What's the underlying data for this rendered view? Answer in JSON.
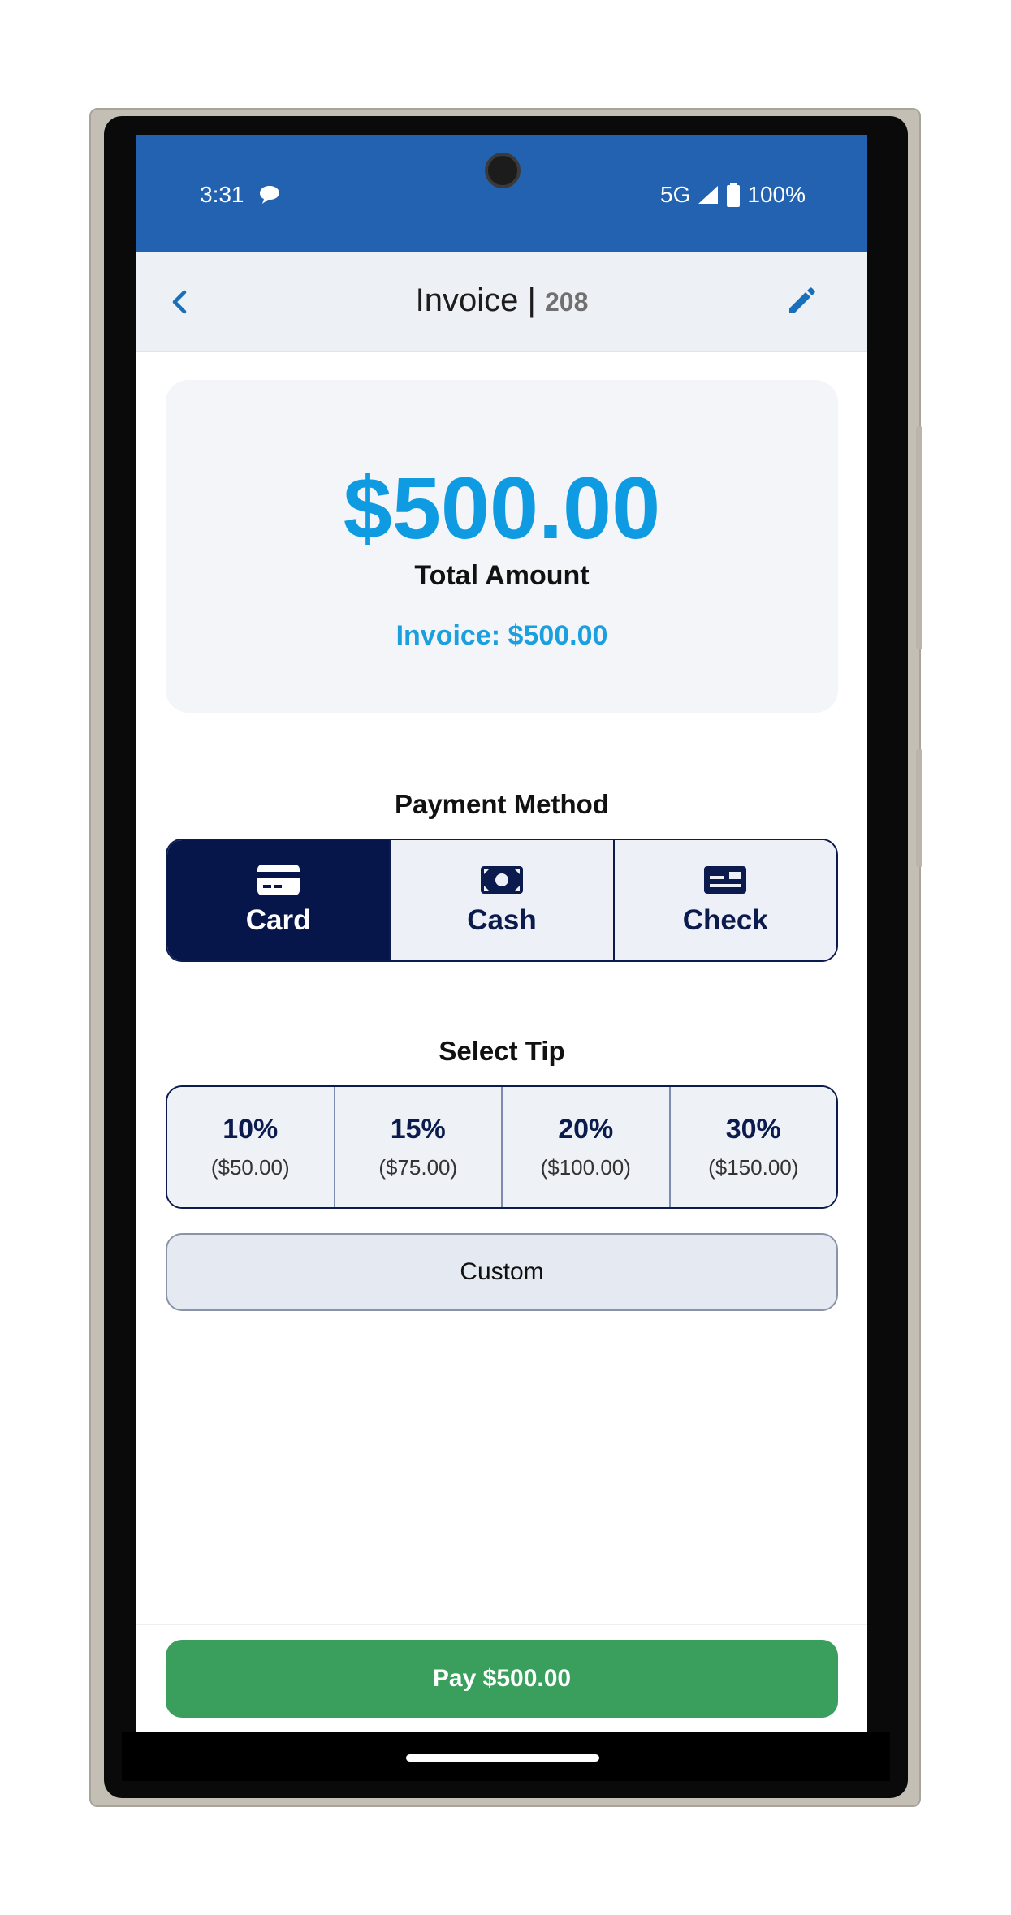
{
  "status_bar": {
    "time": "3:31",
    "network": "5G",
    "battery": "100%"
  },
  "app_bar": {
    "title": "Invoice |",
    "invoice_number": "208"
  },
  "summary": {
    "total_amount": "$500.00",
    "total_label": "Total Amount",
    "invoice_line": "Invoice: $500.00"
  },
  "payment_method": {
    "title": "Payment Method",
    "options": [
      {
        "label": "Card",
        "icon": "credit-card-icon",
        "selected": true
      },
      {
        "label": "Cash",
        "icon": "cash-icon",
        "selected": false
      },
      {
        "label": "Check",
        "icon": "check-icon",
        "selected": false
      }
    ]
  },
  "tip": {
    "title": "Select Tip",
    "options": [
      {
        "percent": "10%",
        "amount": "($50.00)"
      },
      {
        "percent": "15%",
        "amount": "($75.00)"
      },
      {
        "percent": "20%",
        "amount": "($100.00)"
      },
      {
        "percent": "30%",
        "amount": "($150.00)"
      }
    ],
    "custom_label": "Custom"
  },
  "pay_button": {
    "label": "Pay $500.00"
  },
  "colors": {
    "status_bar": "#2262b0",
    "accent_blue": "#0f9be1",
    "navy": "#06154a",
    "pay_green": "#3a9f5c"
  }
}
